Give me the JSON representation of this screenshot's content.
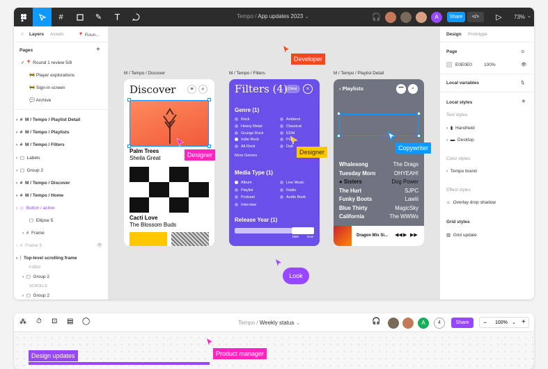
{
  "top_window": {
    "breadcrumb_project": "Tempo",
    "breadcrumb_sep": "/",
    "breadcrumb_file": "App updates 2023",
    "share_label": "Share",
    "avatar_letter": "A",
    "zoom": "73%",
    "left_panel": {
      "tabs": [
        "Layers",
        "Assets",
        "Roun..."
      ],
      "pages_heading": "Pages",
      "pages": [
        "Round 1 review 5/8",
        "Player explorations",
        "Sign-in screen",
        "Archive"
      ],
      "layers": [
        "M / Tempo / Playlist Detail",
        "M / Tempo / Playlists",
        "M / Tempo / Filters",
        "Labels",
        "Group 2",
        "M / Tempo / Discover",
        "M / Tempo / Home",
        "Button / active",
        "Ellipse 5",
        "Frame",
        "Frame 5",
        "Top-level scrolling frame",
        "FIXED",
        "Group 2",
        "SCROLLS",
        "Group 2"
      ]
    },
    "right_panel": {
      "tabs": [
        "Design",
        "Prototype"
      ],
      "page_heading": "Page",
      "page_color": "E0E0E0",
      "page_opacity": "100%",
      "local_variables": "Local variables",
      "local_styles": "Local styles",
      "text_styles": "Text styles",
      "text_style_items": [
        "Handheld",
        "Desktop"
      ],
      "color_styles": "Color styles",
      "color_style_items": [
        "Tempo brand"
      ],
      "effect_styles": "Effect styles",
      "effect_style_items": [
        "Overlay drop shadow"
      ],
      "grid_styles": "Grid styles",
      "grid_style_items": [
        "Grid update"
      ]
    },
    "canvas": {
      "frame_titles": [
        "M / Tempo / Discover",
        "M / Tempo / Filters",
        "M / Tempo / Playlist Detail"
      ],
      "discover": {
        "title": "Discover",
        "track1_title": "Palm Trees",
        "track1_artist": "Sheila Great",
        "track2_title": "Cacti Love",
        "track2_artist": "The Blossom Buds"
      },
      "filters": {
        "title": "Filters (4)",
        "clear": "Clear",
        "genre_heading": "Genre (1)",
        "genres_left": [
          "Rock",
          "Heavy Metal",
          "Grunge Rock",
          "Indie Rock",
          "Alt Rock"
        ],
        "genres_right": [
          "Ambient",
          "Classical",
          "EDM",
          "Pop",
          "Dub"
        ],
        "more_genres": "More Genres",
        "media_heading": "Media Type (1)",
        "media_left": [
          "Album",
          "Playlist",
          "Podcast",
          "Interview"
        ],
        "media_right": [
          "Live Music",
          "Radio",
          "Audio Book"
        ],
        "release_heading": "Release Year (1)",
        "year_from": "1986",
        "year_to": "Now"
      },
      "playlists": {
        "title": "Playlists",
        "rows": [
          {
            "left": "Whalesong",
            "right": "The Drags"
          },
          {
            "left": "Tuesday Morn",
            "right": "OHYEAH!"
          },
          {
            "left": "Sisters",
            "right": "Dog Power"
          },
          {
            "left": "The Hurt",
            "right": "SJPC"
          },
          {
            "left": "Funky Boots",
            "right": "Lawiii"
          },
          {
            "left": "Blue Thirty",
            "right": "MagicSky"
          },
          {
            "left": "California",
            "right": "The WWWs"
          }
        ],
        "now_playing": "Dragon Mix Si..."
      },
      "cursors": [
        {
          "label": "Developer",
          "color": "#f24822"
        },
        {
          "label": "Designer",
          "color": "#ff24bd"
        },
        {
          "label": "Designer",
          "color": "#ffc700"
        },
        {
          "label": "Copywriter",
          "color": "#0d99ff"
        },
        {
          "label": "Look",
          "color": "#9747ff"
        }
      ]
    }
  },
  "bottom_window": {
    "breadcrumb_project": "Tempo",
    "breadcrumb_sep": "/",
    "breadcrumb_file": "Weekly status",
    "share_label": "Share",
    "avatar_letter": "A",
    "avatar_count": "4",
    "zoom": "100%",
    "labels": [
      {
        "label": "Product manager",
        "color": "#ff24bd"
      },
      {
        "label": "Design updates",
        "color": "#9747ff"
      }
    ]
  }
}
